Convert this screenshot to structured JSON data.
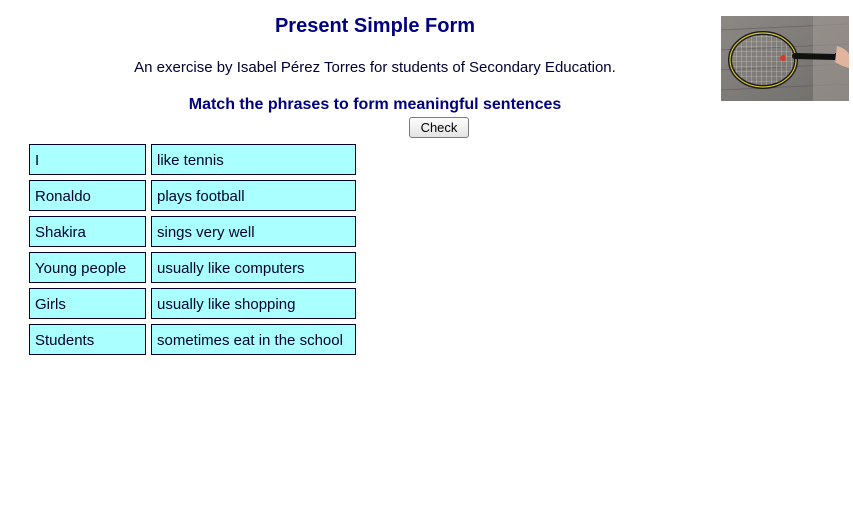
{
  "header": {
    "title": "Present Simple Form",
    "subtitle": "An exercise by Isabel Pérez Torres for students of Secondary Education.",
    "instructions": "Match the phrases to form meaningful sentences",
    "check_label": "Check"
  },
  "photo": {
    "icon": "tennis-racket-photo"
  },
  "rows": [
    {
      "left": "I",
      "right": "like tennis"
    },
    {
      "left": "Ronaldo",
      "right": "plays football"
    },
    {
      "left": "Shakira",
      "right": "sings very well"
    },
    {
      "left": "Young people",
      "right": "usually like computers"
    },
    {
      "left": "Girls",
      "right": "usually like shopping"
    },
    {
      "left": "Students",
      "right": "sometimes eat in the school"
    }
  ],
  "colors": {
    "title": "#000080",
    "cell_background": "#aaffff",
    "cell_border": "#000033"
  }
}
